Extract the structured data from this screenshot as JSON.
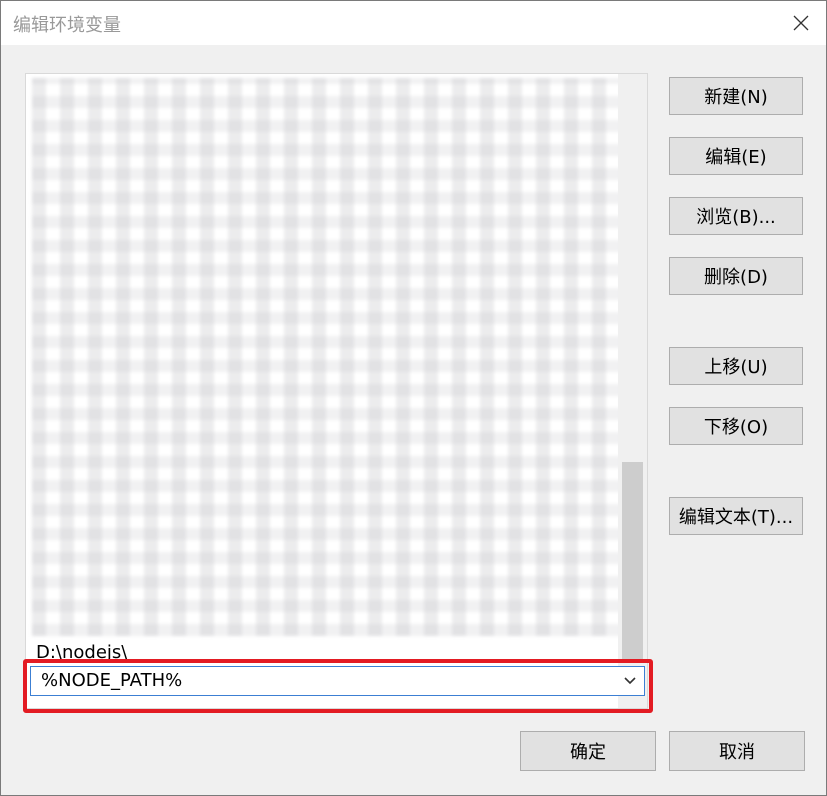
{
  "window": {
    "title": "编辑环境变量"
  },
  "list": {
    "items": [
      "D:\\nodejs\\",
      "%NODE_PATH%"
    ]
  },
  "buttons": {
    "new": "新建(N)",
    "edit": "编辑(E)",
    "browse": "浏览(B)...",
    "delete": "删除(D)",
    "move_up": "上移(U)",
    "move_down": "下移(O)",
    "edit_text": "编辑文本(T)...",
    "ok": "确定",
    "cancel": "取消"
  },
  "icons": {
    "close": "close-icon",
    "dropdown": "chevron-down-icon"
  },
  "colors": {
    "highlight_border": "#e31b23"
  }
}
